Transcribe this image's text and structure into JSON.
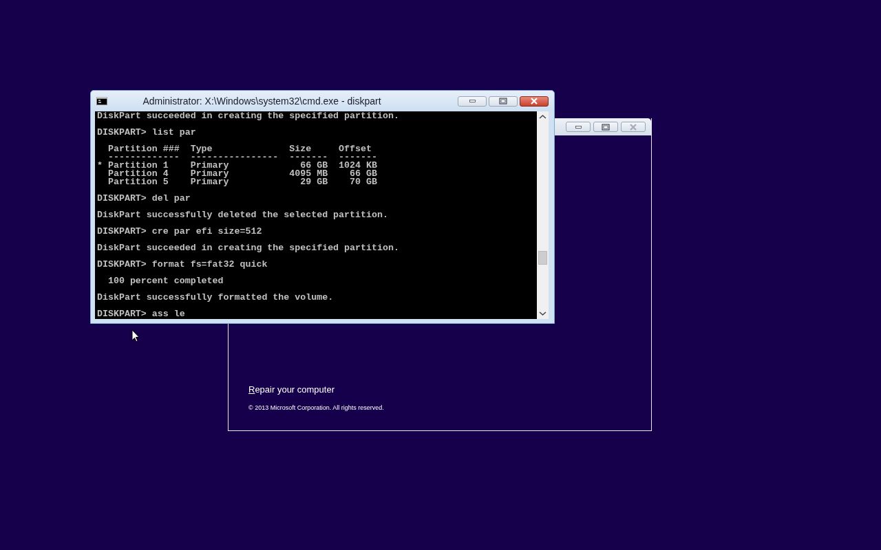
{
  "setup_window": {
    "link": "Repair your computer",
    "copyright": "© 2013 Microsoft Corporation. All rights reserved."
  },
  "cmd_window": {
    "title": "Administrator: X:\\Windows\\system32\\cmd.exe - diskpart",
    "output": [
      [
        "DiskPart succeeded in creating the specified partition."
      ],
      [
        "DISKPART> list par"
      ],
      [
        "  Partition ###  Type              Size     Offset",
        "  -------------  ----------------  -------  -------",
        "* Partition 1    Primary             66 GB  1024 KB",
        "  Partition 4    Primary           4095 MB    66 GB",
        "  Partition 5    Primary             29 GB    70 GB"
      ],
      [
        "DISKPART> del par"
      ],
      [
        "DiskPart successfully deleted the selected partition."
      ],
      [
        "DISKPART> cre par efi size=512"
      ],
      [
        "DiskPart succeeded in creating the specified partition."
      ],
      [
        "DISKPART> format fs=fat32 quick"
      ],
      [
        "  100 percent completed"
      ],
      [
        "DiskPart successfully formatted the volume."
      ],
      [
        "DISKPART> ass le"
      ]
    ]
  }
}
